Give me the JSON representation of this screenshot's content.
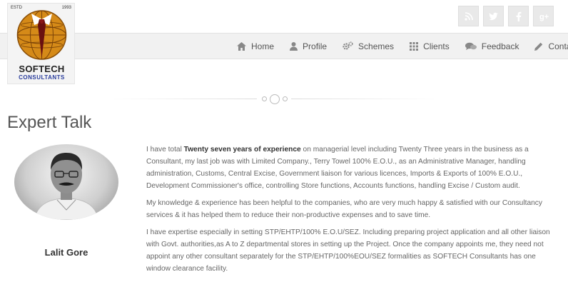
{
  "logo": {
    "estd": "ESTD",
    "year": "1993",
    "name": "SOFTECH",
    "tagline": "CONSULTANTS"
  },
  "social": [
    {
      "icon": "rss-icon",
      "glyph": "◔"
    },
    {
      "icon": "twitter-icon",
      "glyph": "♦"
    },
    {
      "icon": "facebook-icon",
      "glyph": "f"
    },
    {
      "icon": "google-plus-icon",
      "glyph": "g+"
    }
  ],
  "nav": [
    {
      "label": "Home",
      "icon": "home-icon"
    },
    {
      "label": "Profile",
      "icon": "user-icon"
    },
    {
      "label": "Schemes",
      "icon": "gears-icon"
    },
    {
      "label": "Clients",
      "icon": "grid-icon"
    },
    {
      "label": "Feedback",
      "icon": "chat-icon"
    },
    {
      "label": "Contact",
      "icon": "pencil-icon"
    }
  ],
  "section": {
    "title": "Expert Talk",
    "person_name": "Lalit Gore"
  },
  "bio": {
    "p1_pre": "I have total ",
    "p1_bold": "Twenty seven years of experience",
    "p1_post": " on managerial level including Twenty Three years in the business as a Consultant, my last job was with Limited Company., Terry Towel 100% E.O.U., as an Administrative Manager, handling administration, Customs, Central Excise, Government liaison for various licences, Imports & Exports of 100% E.O.U., Development Commissioner's office, controlling Store functions, Accounts functions, handling Excise / Custom audit.",
    "p2": "My knowledge & experience has been helpful to the companies, who are very much happy & satisfied with our Consultancy services & it has helped them to reduce their non-productive expenses and to save time.",
    "p3": "I have expertise especially in setting STP/EHTP/100% E.O.U/SEZ. Including preparing project application and all other liaison with Govt. authorities,as A to Z departmental stores in setting up the Project. Once the company appoints me, they need not appoint any other consultant separately for the STP/EHTP/100%EOU/SEZ formalities as SOFTECH Consultants has one window clearance facility."
  }
}
